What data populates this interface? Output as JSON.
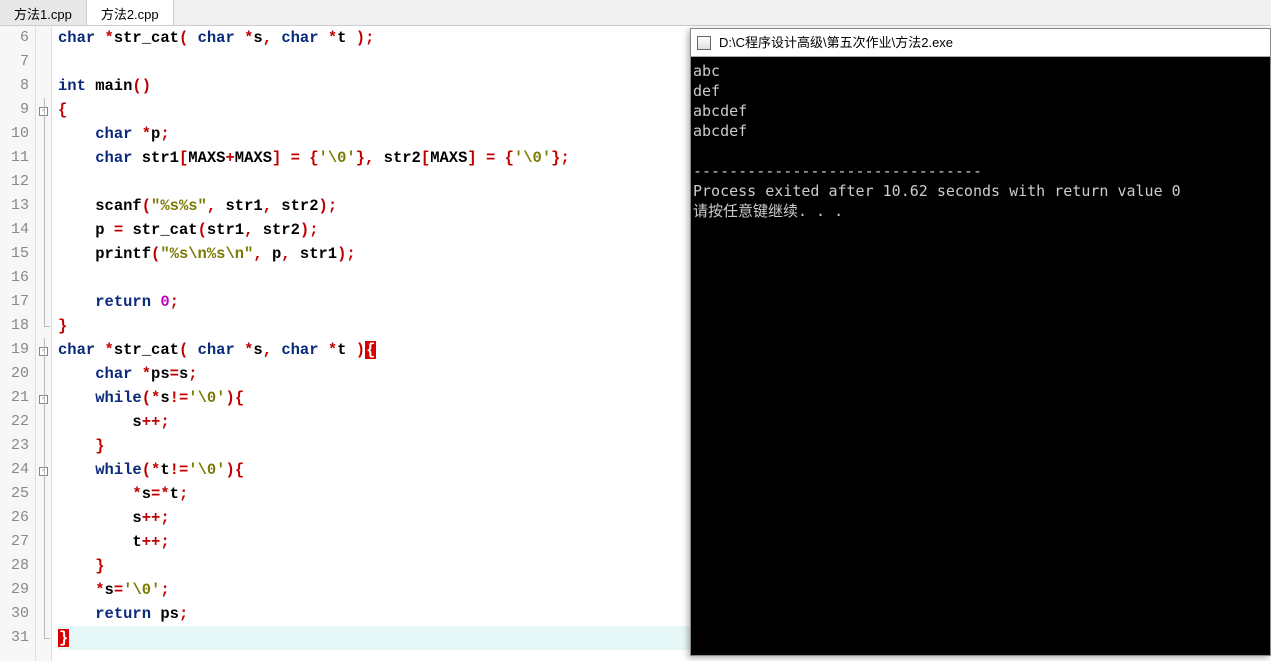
{
  "tabs": [
    {
      "label": "方法1.cpp",
      "active": false
    },
    {
      "label": "方法2.cpp",
      "active": true
    }
  ],
  "line_start": 6,
  "line_end": 31,
  "fold": {
    "9": "box",
    "10": "line",
    "11": "line",
    "12": "line",
    "13": "line",
    "14": "line",
    "15": "line",
    "16": "line",
    "17": "line",
    "18": "end",
    "19": "box",
    "20": "line",
    "21": "box",
    "22": "line",
    "23": "line",
    "24": "box",
    "25": "line",
    "26": "line",
    "27": "line",
    "28": "line",
    "29": "line",
    "30": "line",
    "31": "end"
  },
  "code": {
    "6": [
      [
        "kw",
        "char"
      ],
      [
        "op",
        " *"
      ],
      [
        "id",
        "str_cat"
      ],
      [
        "paren",
        "( "
      ],
      [
        "kw",
        "char"
      ],
      [
        "op",
        " *"
      ],
      [
        "id",
        "s"
      ],
      [
        "op",
        ", "
      ],
      [
        "kw",
        "char"
      ],
      [
        "op",
        " *"
      ],
      [
        "id",
        "t"
      ],
      [
        "paren",
        " )"
      ],
      [
        "op",
        ";"
      ]
    ],
    "7": [],
    "8": [
      [
        "kw",
        "int"
      ],
      [
        "id",
        " main"
      ],
      [
        "paren",
        "()"
      ]
    ],
    "9": [
      [
        "op",
        "{"
      ]
    ],
    "10": [
      [
        "sp",
        "    "
      ],
      [
        "kw",
        "char"
      ],
      [
        "op",
        " *"
      ],
      [
        "id",
        "p"
      ],
      [
        "op",
        ";"
      ]
    ],
    "11": [
      [
        "sp",
        "    "
      ],
      [
        "kw",
        "char"
      ],
      [
        "id",
        " str1"
      ],
      [
        "op",
        "["
      ],
      [
        "id",
        "MAXS"
      ],
      [
        "op",
        "+"
      ],
      [
        "id",
        "MAXS"
      ],
      [
        "op",
        "] = {"
      ],
      [
        "str",
        "'\\0'"
      ],
      [
        "op",
        "}, "
      ],
      [
        "id",
        "str2"
      ],
      [
        "op",
        "["
      ],
      [
        "id",
        "MAXS"
      ],
      [
        "op",
        "] = {"
      ],
      [
        "str",
        "'\\0'"
      ],
      [
        "op",
        "};"
      ]
    ],
    "12": [],
    "13": [
      [
        "sp",
        "    "
      ],
      [
        "id",
        "scanf"
      ],
      [
        "paren",
        "("
      ],
      [
        "str",
        "\"%s%s\""
      ],
      [
        "op",
        ", "
      ],
      [
        "id",
        "str1"
      ],
      [
        "op",
        ", "
      ],
      [
        "id",
        "str2"
      ],
      [
        "paren",
        ")"
      ],
      [
        "op",
        ";"
      ]
    ],
    "14": [
      [
        "sp",
        "    "
      ],
      [
        "id",
        "p"
      ],
      [
        "op",
        " = "
      ],
      [
        "id",
        "str_cat"
      ],
      [
        "paren",
        "("
      ],
      [
        "id",
        "str1"
      ],
      [
        "op",
        ", "
      ],
      [
        "id",
        "str2"
      ],
      [
        "paren",
        ")"
      ],
      [
        "op",
        ";"
      ]
    ],
    "15": [
      [
        "sp",
        "    "
      ],
      [
        "id",
        "printf"
      ],
      [
        "paren",
        "("
      ],
      [
        "str",
        "\"%s\\n%s\\n\""
      ],
      [
        "op",
        ", "
      ],
      [
        "id",
        "p"
      ],
      [
        "op",
        ", "
      ],
      [
        "id",
        "str1"
      ],
      [
        "paren",
        ")"
      ],
      [
        "op",
        ";"
      ]
    ],
    "16": [],
    "17": [
      [
        "sp",
        "    "
      ],
      [
        "kw",
        "return"
      ],
      [
        "id",
        " "
      ],
      [
        "lit",
        "0"
      ],
      [
        "op",
        ";"
      ]
    ],
    "18": [
      [
        "op",
        "}"
      ]
    ],
    "19": [
      [
        "kw",
        "char"
      ],
      [
        "op",
        " *"
      ],
      [
        "id",
        "str_cat"
      ],
      [
        "paren",
        "( "
      ],
      [
        "kw",
        "char"
      ],
      [
        "op",
        " *"
      ],
      [
        "id",
        "s"
      ],
      [
        "op",
        ", "
      ],
      [
        "kw",
        "char"
      ],
      [
        "op",
        " *"
      ],
      [
        "id",
        "t"
      ],
      [
        "paren",
        " )"
      ],
      [
        "bracehl",
        "{"
      ]
    ],
    "20": [
      [
        "sp",
        "    "
      ],
      [
        "kw",
        "char"
      ],
      [
        "op",
        " *"
      ],
      [
        "id",
        "ps"
      ],
      [
        "op",
        "="
      ],
      [
        "id",
        "s"
      ],
      [
        "op",
        ";"
      ]
    ],
    "21": [
      [
        "sp",
        "    "
      ],
      [
        "kw",
        "while"
      ],
      [
        "paren",
        "("
      ],
      [
        "op",
        "*"
      ],
      [
        "id",
        "s"
      ],
      [
        "op",
        "!="
      ],
      [
        "str",
        "'\\0'"
      ],
      [
        "paren",
        ")"
      ],
      [
        "op",
        "{"
      ]
    ],
    "22": [
      [
        "sp",
        "        "
      ],
      [
        "id",
        "s"
      ],
      [
        "op",
        "++;"
      ]
    ],
    "23": [
      [
        "sp",
        "    "
      ],
      [
        "op",
        "}"
      ]
    ],
    "24": [
      [
        "sp",
        "    "
      ],
      [
        "kw",
        "while"
      ],
      [
        "paren",
        "("
      ],
      [
        "op",
        "*"
      ],
      [
        "id",
        "t"
      ],
      [
        "op",
        "!="
      ],
      [
        "str",
        "'\\0'"
      ],
      [
        "paren",
        ")"
      ],
      [
        "op",
        "{"
      ]
    ],
    "25": [
      [
        "sp",
        "        "
      ],
      [
        "op",
        "*"
      ],
      [
        "id",
        "s"
      ],
      [
        "op",
        "=*"
      ],
      [
        "id",
        "t"
      ],
      [
        "op",
        ";"
      ]
    ],
    "26": [
      [
        "sp",
        "        "
      ],
      [
        "id",
        "s"
      ],
      [
        "op",
        "++;"
      ]
    ],
    "27": [
      [
        "sp",
        "        "
      ],
      [
        "id",
        "t"
      ],
      [
        "op",
        "++;"
      ]
    ],
    "28": [
      [
        "sp",
        "    "
      ],
      [
        "op",
        "}"
      ]
    ],
    "29": [
      [
        "sp",
        "    "
      ],
      [
        "op",
        "*"
      ],
      [
        "id",
        "s"
      ],
      [
        "op",
        "="
      ],
      [
        "str",
        "'\\0'"
      ],
      [
        "op",
        ";"
      ]
    ],
    "30": [
      [
        "sp",
        "    "
      ],
      [
        "kw",
        "return"
      ],
      [
        "id",
        " ps"
      ],
      [
        "op",
        ";"
      ]
    ],
    "31": [
      [
        "bracehl",
        "}"
      ]
    ]
  },
  "cursor_line": 31,
  "console": {
    "title": "D:\\C程序设计高级\\第五次作业\\方法2.exe",
    "lines": [
      "abc",
      "def",
      "abcdef",
      "abcdef",
      "",
      "--------------------------------",
      "Process exited after 10.62 seconds with return value 0",
      "请按任意键继续. . ."
    ]
  }
}
